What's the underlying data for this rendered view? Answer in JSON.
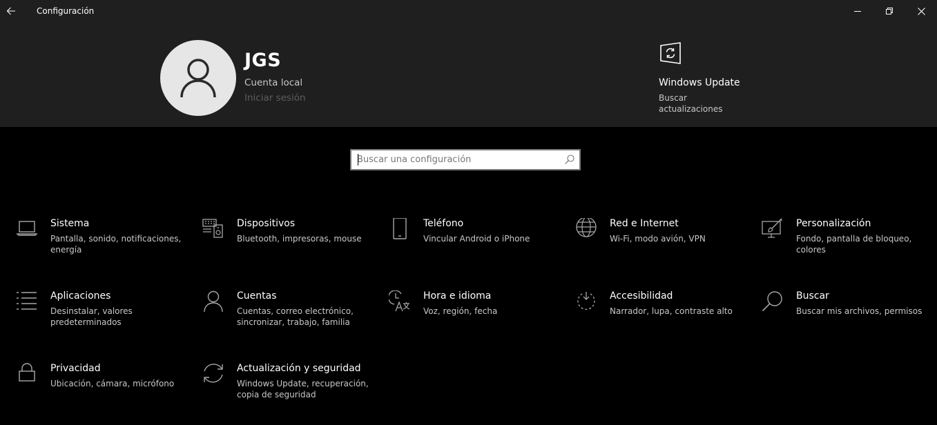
{
  "window": {
    "title": "Configuración"
  },
  "profile": {
    "name": "JGS",
    "account_type": "Cuenta local",
    "sign_in": "Iniciar sesión"
  },
  "update_card": {
    "title": "Windows Update",
    "subtitle": "Buscar actualizaciones"
  },
  "search": {
    "placeholder": "Buscar una configuración"
  },
  "tiles": [
    {
      "name": "Sistema",
      "desc": "Pantalla, sonido, notificaciones, energía",
      "icon": "laptop-icon"
    },
    {
      "name": "Dispositivos",
      "desc": "Bluetooth, impresoras, mouse",
      "icon": "devices-icon"
    },
    {
      "name": "Teléfono",
      "desc": "Vincular Android o iPhone",
      "icon": "phone-icon"
    },
    {
      "name": "Red e Internet",
      "desc": "Wi-Fi, modo avión, VPN",
      "icon": "globe-icon"
    },
    {
      "name": "Personalización",
      "desc": "Fondo, pantalla de bloqueo, colores",
      "icon": "paint-icon"
    },
    {
      "name": "Aplicaciones",
      "desc": "Desinstalar, valores predeterminados",
      "icon": "apps-list-icon"
    },
    {
      "name": "Cuentas",
      "desc": "Cuentas, correo electrónico, sincronizar, trabajo, familia",
      "icon": "person-icon"
    },
    {
      "name": "Hora e idioma",
      "desc": "Voz, región, fecha",
      "icon": "time-language-icon"
    },
    {
      "name": "Accesibilidad",
      "desc": "Narrador, lupa, contraste alto",
      "icon": "accessibility-icon"
    },
    {
      "name": "Buscar",
      "desc": "Buscar mis archivos, permisos",
      "icon": "search-icon"
    },
    {
      "name": "Privacidad",
      "desc": "Ubicación, cámara, micrófono",
      "icon": "lock-icon"
    },
    {
      "name": "Actualización y seguridad",
      "desc": "Windows Update, recuperación, copia de seguridad",
      "icon": "sync-icon"
    }
  ],
  "colors": {
    "header_bg": "#1f1f1f",
    "page_bg": "#000000",
    "secondary_text": "#c8c8c8",
    "disabled_text": "#5d5d5d"
  }
}
